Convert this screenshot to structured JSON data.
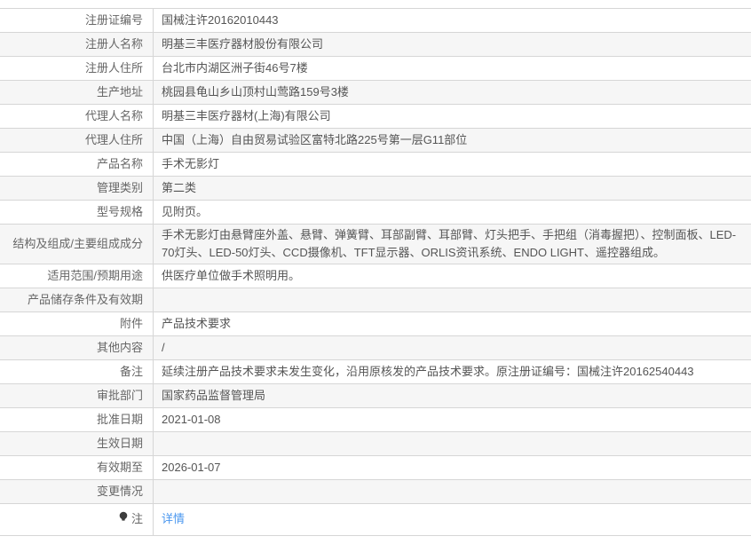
{
  "colors": {
    "row_stripe": "#f6f6f6",
    "border": "#d6d6d6",
    "label_text": "#666666",
    "value_text": "#555555",
    "link_blue": "#4a97ef",
    "note_icon": "#3d3d3d"
  },
  "table": {
    "rows": [
      {
        "label": "注册证编号",
        "value": "国械注许20162010443"
      },
      {
        "label": "注册人名称",
        "value": "明基三丰医疗器材股份有限公司"
      },
      {
        "label": "注册人住所",
        "value": "台北市内湖区洲子街46号7楼"
      },
      {
        "label": "生产地址",
        "value": "桃园县龟山乡山顶村山莺路159号3楼"
      },
      {
        "label": "代理人名称",
        "value": "明基三丰医疗器材(上海)有限公司"
      },
      {
        "label": "代理人住所",
        "value": "中国（上海）自由贸易试验区富特北路225号第一层G11部位"
      },
      {
        "label": "产品名称",
        "value": "手术无影灯"
      },
      {
        "label": "管理类别",
        "value": "第二类"
      },
      {
        "label": "型号规格",
        "value": "见附页。"
      },
      {
        "label": "结构及组成/主要组成成分",
        "value": "手术无影灯由悬臂座外盖、悬臂、弹簧臂、耳部副臂、耳部臂、灯头把手、手把组（消毒握把）、控制面板、LED-70灯头、LED-50灯头、CCD摄像机、TFT显示器、ORLIS资讯系统、ENDO LIGHT、遥控器组成。"
      },
      {
        "label": "适用范围/预期用途",
        "value": "供医疗单位做手术照明用。"
      },
      {
        "label": "产品储存条件及有效期",
        "value": ""
      },
      {
        "label": "附件",
        "value": "产品技术要求"
      },
      {
        "label": "其他内容",
        "value": "/"
      },
      {
        "label": "备注",
        "value": "延续注册产品技术要求未发生变化，沿用原核发的产品技术要求。原注册证编号：国械注许20162540443"
      },
      {
        "label": "审批部门",
        "value": "国家药品监督管理局"
      },
      {
        "label": "批准日期",
        "value": "2021-01-08"
      },
      {
        "label": "生效日期",
        "value": ""
      },
      {
        "label": "有效期至",
        "value": "2026-01-07"
      },
      {
        "label": "变更情况",
        "value": ""
      },
      {
        "label": "注",
        "value": "详情"
      }
    ],
    "note_row": {
      "icon": "bulb-icon",
      "label": "注",
      "link_label": "详情"
    }
  }
}
